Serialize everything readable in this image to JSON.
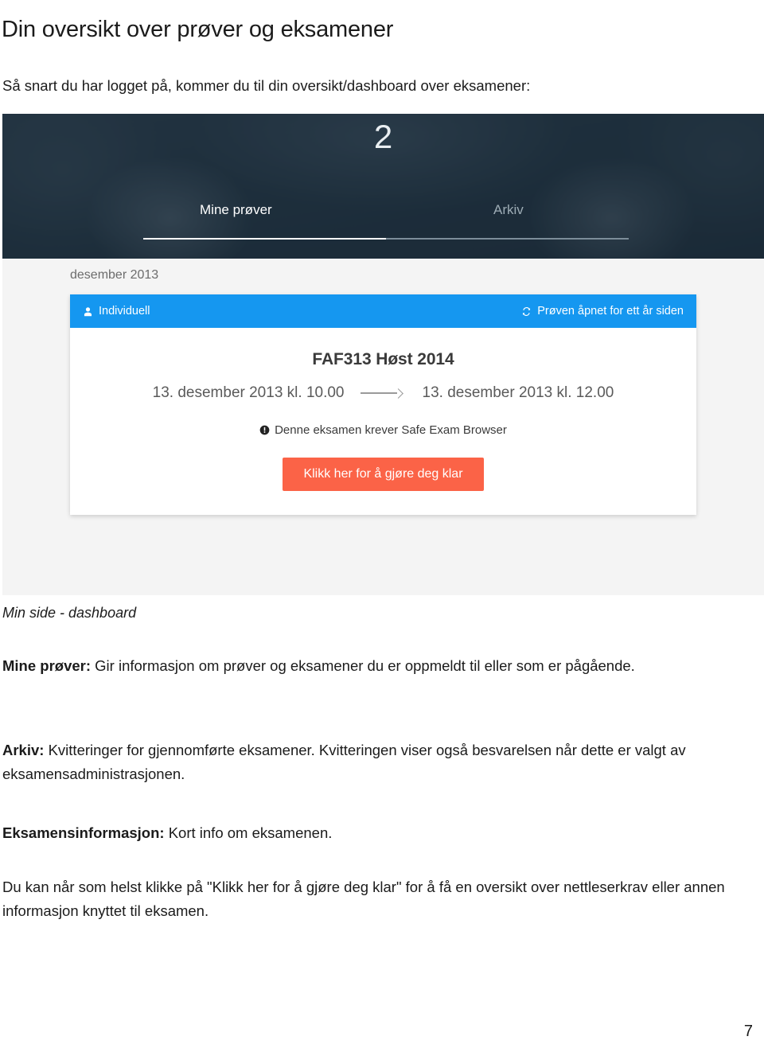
{
  "document": {
    "title": "Din oversikt over prøver og eksamener",
    "intro": "Så snart du har logget på, kommer du til din oversikt/dashboard over eksamener:",
    "page_number": "7"
  },
  "screenshot": {
    "header": {
      "logo": "2",
      "tabs": [
        {
          "label": "Mine prøver",
          "active": true
        },
        {
          "label": "Arkiv",
          "active": false
        }
      ]
    },
    "list": {
      "month_label": "desember 2013",
      "card": {
        "bar": {
          "type_label": "Individuell",
          "type_icon": "user-icon",
          "status_label": "Prøven åpnet for ett år siden",
          "status_icon": "refresh-icon"
        },
        "exam_title": "FAF313 Høst 2014",
        "start_time": "13. desember 2013 kl. 10.00",
        "end_time": "13. desember 2013 kl. 12.00",
        "requirement_icon": "exclamation-circle-icon",
        "requirement_text": "Denne eksamen krever Safe Exam Browser",
        "cta_label": "Klikk her for å gjøre deg klar"
      }
    },
    "colors": {
      "header_bg": "#223240",
      "card_bar_blue": "#1597f0",
      "cta_orange": "#fb6347",
      "list_bg": "#f4f4f4"
    }
  },
  "prose": {
    "caption": "Min side - dashboard",
    "p1_label": "Mine prøver:",
    "p1_text": " Gir informasjon om prøver og eksamener du er oppmeldt til eller som er pågående.",
    "p2_label": "Arkiv:",
    "p2_text": " Kvitteringer for gjennomførte eksamener. Kvitteringen viser også besvarelsen når dette er valgt av eksamensadministrasjonen.",
    "p3_label": "Eksamensinformasjon:",
    "p3_text": " Kort info om eksamenen.",
    "p4_text": "Du kan når som helst klikke på \"Klikk her for å gjøre deg klar\" for å få en oversikt over nettleserkrav eller annen informasjon knyttet til eksamen."
  }
}
